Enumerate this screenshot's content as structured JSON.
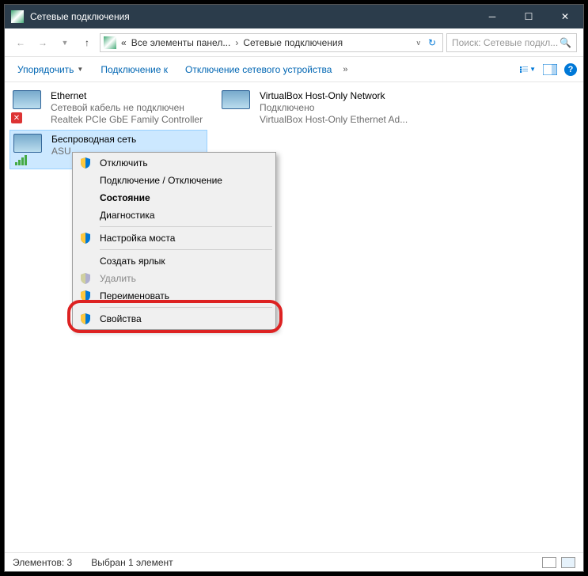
{
  "window": {
    "title": "Сетевые подключения"
  },
  "nav": {
    "crumb_prefix": "«",
    "crumb1": "Все элементы панел...",
    "crumb2": "Сетевые подключения"
  },
  "search": {
    "placeholder": "Поиск: Сетевые подкл..."
  },
  "toolbar": {
    "organize": "Упорядочить",
    "connect": "Подключение к",
    "disable": "Отключение сетевого устройства",
    "more": "»"
  },
  "adapters": {
    "ethernet": {
      "name": "Ethernet",
      "status": "Сетевой кабель не подключен",
      "device": "Realtek PCIe GbE Family Controller"
    },
    "vbox": {
      "name": "VirtualBox Host-Only Network",
      "status": "Подключено",
      "device": "VirtualBox Host-Only Ethernet Ad..."
    },
    "wifi": {
      "name": "Беспроводная сеть",
      "ssid": "ASU"
    }
  },
  "menu": {
    "disable": "Отключить",
    "connect": "Подключение / Отключение",
    "status": "Состояние",
    "diagnose": "Диагностика",
    "bridge": "Настройка моста",
    "shortcut": "Создать ярлык",
    "delete": "Удалить",
    "rename": "Переименовать",
    "properties": "Свойства"
  },
  "statusbar": {
    "count": "Элементов: 3",
    "selected": "Выбран 1 элемент"
  }
}
